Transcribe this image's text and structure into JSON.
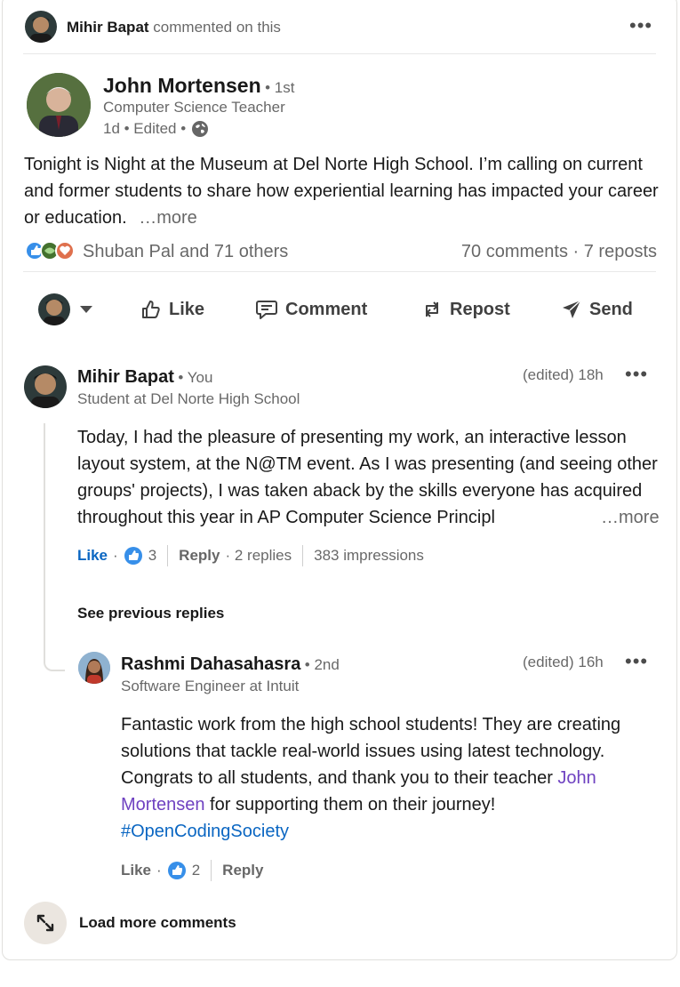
{
  "activity": {
    "actor": "Mihir Bapat",
    "action": "commented on this"
  },
  "post": {
    "author": "John Mortensen",
    "degree": "• 1st",
    "headline": "Computer Science Teacher",
    "meta": "1d • Edited •",
    "text": "Tonight is Night at the Museum at Del Norte High School. I’m calling on current and former students to share how experiential learning has impacted your career or education.",
    "more": "…more",
    "reactions_text": "Shuban Pal and 71 others",
    "comments_reposts": "70 comments · 7 reposts"
  },
  "actions": {
    "like": "Like",
    "comment": "Comment",
    "repost": "Repost",
    "send": "Send"
  },
  "comment1": {
    "author": "Mihir Bapat",
    "badge": "• You",
    "headline": "Student at Del Norte High School",
    "time": "(edited) 18h",
    "text": "Today, I had the pleasure of presenting my work, an interactive lesson layout system, at the N@TM event. As I was presenting (and seeing other groups' projects), I was taken aback by the skills everyone has acquired throughout this year in AP Computer Science Principl",
    "more": "…more",
    "like": "Like",
    "dot": "·",
    "like_count": "3",
    "reply": "Reply",
    "replies": "· 2 replies",
    "impressions": "383 impressions"
  },
  "see_previous": "See previous replies",
  "reply1": {
    "author": "Rashmi Dahasahasra",
    "degree": "• 2nd",
    "headline": "Software Engineer at Intuit",
    "time": "(edited) 16h",
    "text_a": "Fantastic work from the high school students! They are creating solutions that tackle real-world issues using latest technology. Congrats to all students, and thank you to their teacher ",
    "mention": "John Mortensen",
    "text_b": " for supporting them on their journey!",
    "hashtag": "#OpenCodingSociety",
    "like": "Like",
    "dot": "·",
    "like_count": "2",
    "reply": "Reply"
  },
  "load_more": "Load more comments",
  "colors": {
    "accent": "#0a66c2",
    "mention": "#6f42c1",
    "divider": "#e8e8e8"
  }
}
